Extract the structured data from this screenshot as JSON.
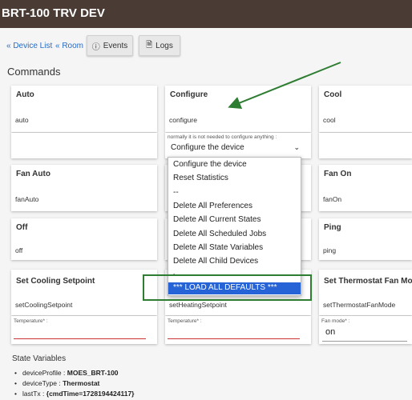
{
  "header": {
    "title": "BRT-100 TRV DEV"
  },
  "nav": {
    "device_list": "« Device List",
    "room": "« Room",
    "events": "Events",
    "logs": "Logs"
  },
  "commands_title": "Commands",
  "cards": {
    "auto": {
      "title": "Auto",
      "cmd": "auto"
    },
    "configure": {
      "title": "Configure",
      "cmd": "configure",
      "note": "normally it is not needed to configure anything :",
      "select_value": "Configure the device"
    },
    "cool": {
      "title": "Cool",
      "cmd": "cool"
    },
    "fan_auto": {
      "title": "Fan Auto",
      "cmd": "fanAuto"
    },
    "fan_on": {
      "title": "Fan On",
      "cmd": "fanOn"
    },
    "off": {
      "title": "Off",
      "cmd": "off"
    },
    "ping": {
      "title": "Ping",
      "cmd": "ping"
    },
    "set_cooling": {
      "title": "Set Cooling Setpoint",
      "cmd": "setCoolingSetpoint",
      "param": "Temperature* :"
    },
    "set_heating": {
      "cmd": "setHeatingSetpoint",
      "param": "Temperature* :"
    },
    "set_fan_mode": {
      "title": "Set Thermostat Fan Mode",
      "cmd": "setThermostatFanMode",
      "param": "Fan mode* :",
      "value": "on"
    }
  },
  "dropdown": {
    "options": [
      "Configure the device",
      "Reset Statistics",
      "--",
      "Delete All Preferences",
      "Delete All Current States",
      "Delete All Scheduled Jobs",
      "Delete All State Variables",
      "Delete All Child Devices",
      "-",
      "*** LOAD ALL DEFAULTS ***"
    ]
  },
  "state_variables": {
    "title": "State Variables",
    "items": [
      {
        "key": "deviceProfile",
        "value": "MOES_BRT-100"
      },
      {
        "key": "deviceType",
        "value": "Thermostat"
      },
      {
        "key": "lastTx",
        "value": "{cmdTime=1728194424117}"
      }
    ]
  },
  "colors": {
    "header_bg": "#4a3b34",
    "link": "#2a6cc4",
    "annotation_green": "#2e7d32",
    "selected_bg": "#2563d6"
  },
  "icons": {
    "events": "info-icon",
    "logs": "document-icon"
  }
}
